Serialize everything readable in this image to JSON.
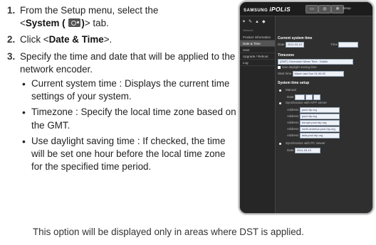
{
  "steps": [
    {
      "num": "1.",
      "pre": "From the Setup menu, select the",
      "sys_open": "<",
      "sys_label": "System (",
      "sys_close": ")",
      "sys_tail": "> tab."
    },
    {
      "num": "2.",
      "pre": "Click <",
      "bold": "Date & Time",
      "post": ">."
    },
    {
      "num": "3.",
      "text": "Specify the time and date that will be applied to the network encoder."
    }
  ],
  "bullets": [
    "Current system time : Displays the current time settings of your system.",
    "Timezone : Specify the local time zone based on the GMT.",
    "Use daylight saving time : If checked, the time will be set one hour before the local time zone for the specified time period."
  ],
  "note": "This option will be displayed only in areas where DST is applied.",
  "icons": {
    "system_tab": "camera-gear-icon"
  },
  "screenshot": {
    "brand": "SAMSUNG",
    "product": "iPOLiS",
    "setup_label": "Setup",
    "sidebar_label": "Network",
    "sidebar_items": [
      "Product information",
      "Date & Time",
      "User",
      "Upgrade / Reboot",
      "Log"
    ],
    "sections": {
      "current_time": "Current system time",
      "timezone": "Timezone",
      "setup": "System time setup"
    },
    "date_label": "Date",
    "date_value": "2011-03-10",
    "time_label": "Time",
    "timezone_value": "(GMT) Greenwich Mean Time : Dublin",
    "dst_label": "Use daylight saving time",
    "start_label": "Start time",
    "start_value": "March last Sun 01:00:00",
    "manual_label": "Manual",
    "sync_ntp_label": "Synchronize with NTP server",
    "address_label": "Address",
    "ntp_servers": [
      "pool.ntp.org",
      "pool.ntp.org",
      "europe.pool.ntp.org",
      "north-america.pool.ntp.org",
      "asia.pool.ntp.org"
    ],
    "sync_pc_label": "Synchronize with PC viewer",
    "pc_value": "2011-03-10"
  }
}
